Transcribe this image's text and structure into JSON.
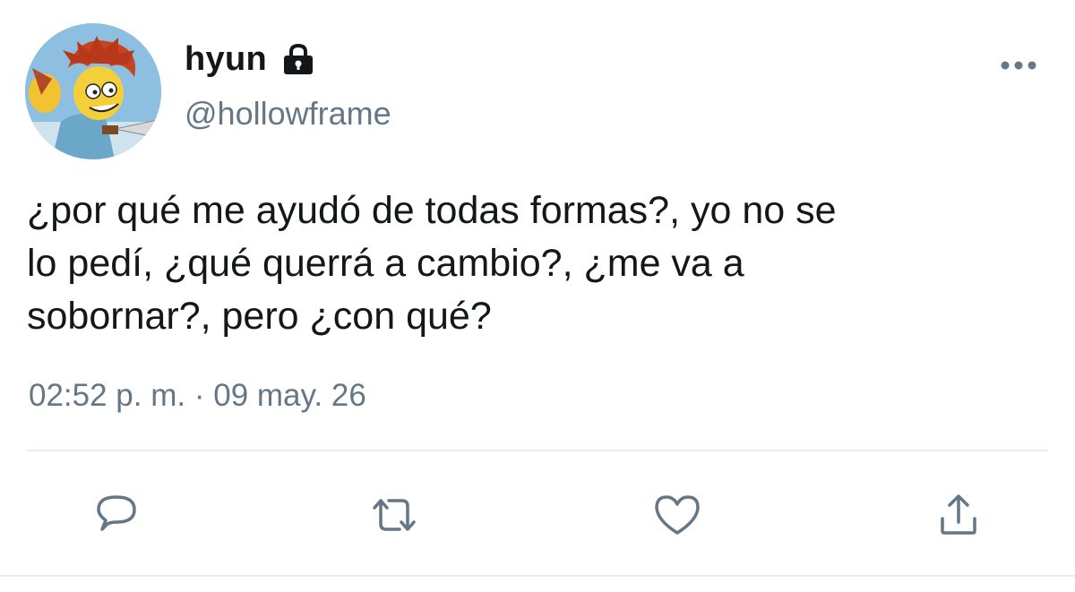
{
  "author": {
    "display_name": "hyun",
    "handle": "@hollowframe",
    "protected": true
  },
  "tweet": {
    "text": "¿por qué me ayudó de todas formas?, yo no se\nlo pedí, ¿qué querrá a cambio?, ¿me va a\nsobornar?, pero ¿con qué?",
    "time": "02:52 p. m.",
    "separator": "·",
    "date": "09 may. 26"
  },
  "icons": {
    "lock": "lock-icon",
    "more": "more-icon",
    "reply": "reply-icon",
    "retweet": "retweet-icon",
    "like": "heart-icon",
    "share": "share-icon"
  },
  "colors": {
    "text": "#14171a",
    "secondary": "#657786",
    "divider": "#e6ecf0"
  }
}
